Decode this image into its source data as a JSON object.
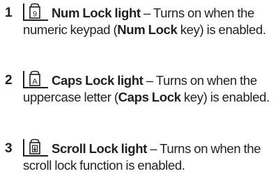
{
  "items": [
    {
      "number": "1",
      "icon": "num-lock-icon",
      "title": "Num Lock light",
      "dash": " – ",
      "desc_1": "Turns on when the numeric keypad (",
      "key": "Num Lock",
      "desc_2": " key) is enabled."
    },
    {
      "number": "2",
      "icon": "caps-lock-icon",
      "title": "Caps Lock light",
      "dash": " – ",
      "desc_1": "Turns on when the uppercase letter (",
      "key": "Caps Lock",
      "desc_2": " key) is enabled."
    },
    {
      "number": "3",
      "icon": "scroll-lock-icon",
      "title": "Scroll Lock light",
      "dash": " – ",
      "desc_1": "Turns on when the scroll lock function is enabled."
    }
  ]
}
